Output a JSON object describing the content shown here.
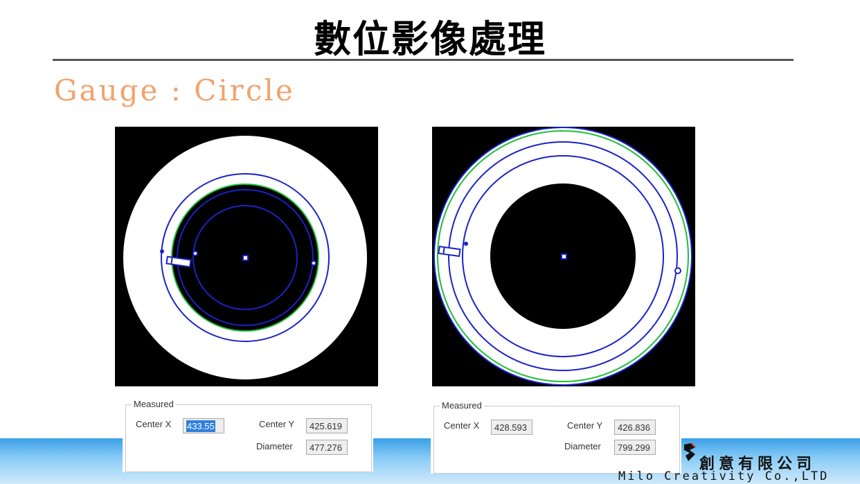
{
  "slide": {
    "title": "數位影像處理",
    "subtitle": "Gauge : Circle"
  },
  "left_panel": {
    "legend": "Measured",
    "center_x_label": "Center X",
    "center_x_value": "433.55",
    "center_y_label": "Center Y",
    "center_y_value": "425.619",
    "diameter_label": "Diameter",
    "diameter_value": "477.276"
  },
  "right_panel": {
    "legend": "Measured",
    "center_x_label": "Center X",
    "center_x_value": "428.593",
    "center_y_label": "Center Y",
    "center_y_value": "426.836",
    "diameter_label": "Diameter",
    "diameter_value": "799.299"
  },
  "footer": {
    "company_zh": "創意有限公司",
    "company_en": "Milo Creativity Co.,LTD"
  },
  "colors": {
    "gauge_circle": "#1a22c8",
    "fit_circle": "#1fbf3a",
    "subtitle": "#f2a26b",
    "selection": "#2f7fdc"
  }
}
